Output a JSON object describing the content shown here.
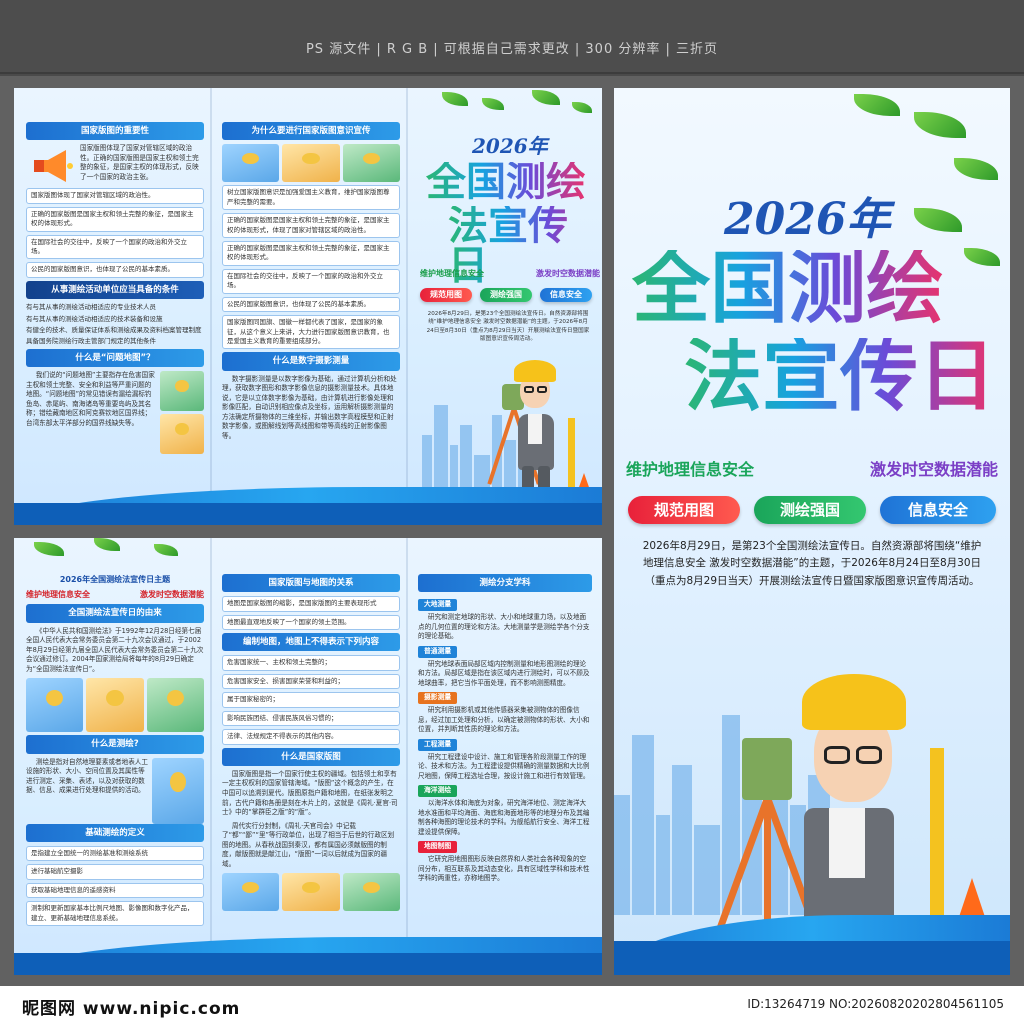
{
  "header": {
    "text": "PS 源文件 | R G B | 可根据自己需求更改 | 300 分辨率 | 三折页"
  },
  "footer": {
    "logo": "昵图网 www.nipic.com",
    "id": "ID:13264719 NO:20260820202804561105"
  },
  "cover": {
    "year": "2026年",
    "title_line1": "全国测绘",
    "title_line2": "法宣传日",
    "slogan_left": "维护地理信息安全",
    "slogan_right": "激发时空数据潜能",
    "tags": [
      "规范用图",
      "测绘强国",
      "信息安全"
    ],
    "intro": "2026年8月29日，是第23个全国测绘法宣传日。自然资源部将围绕“维护地理信息安全 激发时空数据潜能”的主题，于2026年8月24日至8月30日（重点为8月29日当天）开展测绘法宣传日暨国家版图意识宣传周活动。"
  },
  "sheet_a": {
    "p1": {
      "title": "国家版图的重要性",
      "intro": "国家版图体现了国家对管辖区域的政治性。正确的国家版图是国家主权和领土完整的象征，是国家主权的体现形式，反映了一个国家的政治主张。",
      "items": [
        "国家版图体现了国家对管辖区域的政治性。",
        "正确的国家版图是国家主权和领土完整的象征，是国家主权的体现形式。",
        "在国际社会的交往中，反映了一个国家的政治和外交立场。",
        "公民的国家版图意识，也体现了公民的基本素质。"
      ],
      "title2": "从事测绘活动单位应当具备的条件",
      "conds": [
        "有与其从事的测绘活动相适应的专业技术人员",
        "有与其从事的测绘活动相适应的技术装备和设施",
        "有健全的技术、质量保证体系和测绘成果及资料档案管理制度",
        "具备国务院测绘行政主管部门规定的其他条件"
      ],
      "title3": "什么是“问题地图”？",
      "text3": "我们说的“问题地图”主要指存在危害国家主权和领土完整、安全和利益等严重问题的地图。“问题地图”的常见错误有漏绘漏标钓鱼岛、赤尾屿、南海诸岛等重要岛屿及其名称；错绘藏南地区和阿克赛钦地区国界线；台湾东部太平洋部分的国界线缺失等。"
    },
    "p2": {
      "title": "为什么要进行国家版图意识宣传",
      "items": [
        "树立国家版图意识是加强爱国主义教育，维护国家版图尊严和完整的需要。",
        "正确的国家版图是国家主权和领土完整的象征，是国家主权的体现形式，体现了国家对管辖区域的政治性。",
        "正确的国家版图是国家主权和领土完整的象征，是国家主权的体现形式。",
        "在国际社会的交往中，反映了一个国家的政治和外交立场。",
        "公民的国家版图意识，也体现了公民的基本素质。",
        "国家版图同国旗、国徽一样都代表了国家，是国家的象征，从这个意义上来讲，大力进行国家版图意识教育，也是爱国主义教育的重要组成部分。"
      ],
      "title2": "什么是数字摄影测量",
      "text2": "数字摄影测量是以数字影像为基础，通过计算机分析和处理，获取数字图形和数字影像信息的摄影测量技术。具体地说，它是以立体数字影像为基础，由计算机进行影像处理和影像匹配，自动识别相应像点及坐标，运用解析摄影测量的方法确定所摄物体的三维坐标，并输出数字高程模型和正射数字影像，或图解线划等高线图和带等高线的正射影像图等。"
    },
    "p3": {
      "year": "2026年",
      "title_line1": "全国测绘",
      "title_line2": "法宣传日",
      "slogan_left": "维护地理信息安全",
      "slogan_right": "激发时空数据潜能",
      "tags": [
        "规范用图",
        "测绘强国",
        "信息安全"
      ],
      "intro": "2026年8月29日，是第23个全国测绘法宣传日。自然资源部将围绕“维护地理信息安全 激发时空数据潜能”的主题，于2026年8月24日至8月30日（重点为8月29日当天）开展测绘法宣传日暨国家版图意识宣传周活动。"
    }
  },
  "sheet_b": {
    "p1": {
      "title": "2026年全国测绘法宣传日主题",
      "theme_left": "维护地理信息安全",
      "theme_right": "激发时空数据潜能",
      "title2": "全国测绘法宣传日的由来",
      "text2": "《中华人民共和国测绘法》于1992年12月28日经第七届全国人民代表大会常务委员会第二十九次会议通过，于2002年8月29日经第九届全国人民代表大会常务委员会第二十九次会议通过修订。2004年国家测绘局将每年的8月29日确定为“全国测绘法宣传日”。",
      "title3": "什么是测绘?",
      "text3": "测绘是指对自然地理要素或者地表人工设施的形状、大小、空间位置及其属性等进行测定、采集、表述，以及对获取的数据、信息、成果进行处理和提供的活动。",
      "title4": "基础测绘的定义",
      "items4": [
        "是指建立全国统一的测绘基准和测绘系统",
        "进行基础航空摄影",
        "获取基础地理信息的遥感资料",
        "测制和更新国家基本比例尺地图、影像图和数字化产品，建立、更新基础地理信息系统。"
      ]
    },
    "p2": {
      "title": "国家版图与地图的关系",
      "items": [
        "地图是国家版图的缩影，是国家版图的主要表现形式",
        "地图最直观地反映了一个国家的领土范围。"
      ],
      "title2": "编制地图，地图上不得表示下列内容",
      "items2": [
        "危害国家统一、主权和领土完整的；",
        "危害国家安全、损害国家荣誉和利益的；",
        "属于国家秘密的；",
        "影响民族团结、侵害民族风俗习惯的；",
        "法律、法规规定不得表示的其他内容。"
      ],
      "title3": "什么是国家版图",
      "text3a": "国家版图是指一个国家行使主权的疆域。包括领土和享有一定主权权利的国家管辖海域。“版图”这个概念的产生，在中国可以追溯到夏代。版图原指户籍和地图，在纸张发明之前，古代户籍和各册是刻在木片上的，这就是《周礼·夏官·司士》中的“掌群臣之版”的“版”。",
      "text3b": "周代实行分封制，《周礼·天官司会》中记载了“都”“鄙”“里”等行政单位，出现了相当于后世的行政区划图的地图。从春秋战国到秦汉，都有属国必须献版图的制度，献版图就是献江山，“版图”一词以后就成为国家的疆域。"
    },
    "p3": {
      "title": "测绘分支学科",
      "sections": [
        {
          "name": "大地测量",
          "text": "研究和测定地球的形状、大小和地球重力场，以及地面点的几何位置的理论和方法。大地测量学是测绘学各个分支的理论基础。"
        },
        {
          "name": "普通测量",
          "text": "研究地球表面局部区域内控制测量和地形图测绘的理论和方法。局部区域是指在该区域内进行测绘时，可以不顾及地球曲率，把它当作平面处理，而不影响测图精度。"
        },
        {
          "name": "摄影测量",
          "text": "研究利用摄影机或其他传感器采集被测物体的图像信息，经过加工处理和分析，以确定被测物体的形状、大小和位置，并判断其性质的理论和方法。"
        },
        {
          "name": "工程测量",
          "text": "研究工程建设中设计、施工和管理各阶段测量工作的理论、技术和方法。为工程建设提供精确的测量数据和大比例尺地图，保障工程选址合理，按设计施工和进行有效管理。"
        },
        {
          "name": "海洋测绘",
          "text": "以海洋水体和海底为对象，研究海洋地位、测定海洋大地水准面和平均海面、海底和海面地形等的地理分布及其编制各种海图的理论技术的学科。为舰船航行安全、海洋工程建设提供保障。"
        },
        {
          "name": "地图制图",
          "text": "它研究用地图图形反映自然界和人类社会各种现象的空间分布，相互联系及其动态变化，具有区域性学科和技术性学科的两重性，亦称地图学。"
        }
      ]
    }
  },
  "colors": {
    "brand_blue": "#1d6fd0",
    "accent_red": "#e8213a",
    "accent_green": "#1aa55a"
  }
}
